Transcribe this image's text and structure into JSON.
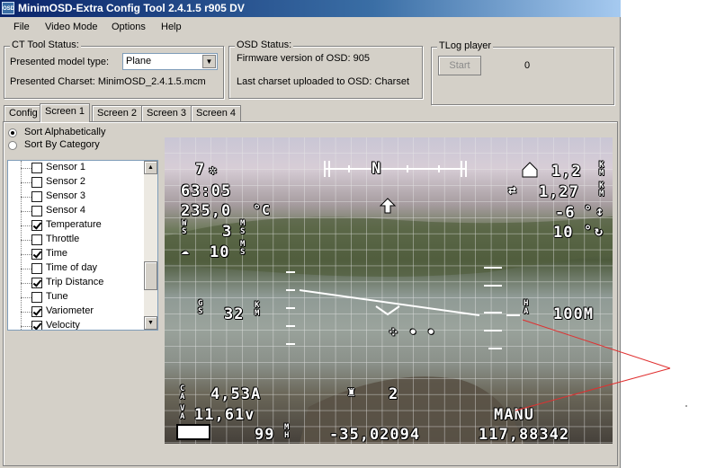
{
  "window": {
    "title": "MinimOSD-Extra Config Tool 2.4.1.5 r905 DV",
    "icon_label": "OSD"
  },
  "menu": [
    "File",
    "Video Mode",
    "Options",
    "Help"
  ],
  "ct_status": {
    "legend": "CT Tool Status:",
    "model_label": "Presented model type:",
    "model_value": "Plane",
    "charset_label": "Presented Charset: MinimOSD_2.4.1.5.mcm"
  },
  "osd_status": {
    "legend": "OSD Status:",
    "firmware": "Firmware version of OSD: 905",
    "charset": "Last charset uploaded to OSD: Charset"
  },
  "tlog": {
    "legend": "TLog player",
    "start_label": "Start",
    "count": "0"
  },
  "tabs": [
    {
      "label": "Config",
      "active": false
    },
    {
      "label": "Screen 1",
      "active": true
    },
    {
      "label": "Screen 2",
      "active": false
    },
    {
      "label": "Screen 3",
      "active": false
    },
    {
      "label": "Screen 4",
      "active": false
    }
  ],
  "sort": {
    "alphabetical": "Sort Alphabetically",
    "category": "Sort By Category",
    "selected": "alphabetical"
  },
  "items": [
    {
      "label": "Sensor 1",
      "checked": false
    },
    {
      "label": "Sensor 2",
      "checked": false
    },
    {
      "label": "Sensor 3",
      "checked": false
    },
    {
      "label": "Sensor 4",
      "checked": false
    },
    {
      "label": "Temperature",
      "checked": true
    },
    {
      "label": "Throttle",
      "checked": false
    },
    {
      "label": "Time",
      "checked": true
    },
    {
      "label": "Time of day",
      "checked": false
    },
    {
      "label": "Trip Distance",
      "checked": true
    },
    {
      "label": "Tune",
      "checked": false
    },
    {
      "label": "Variometer",
      "checked": true
    },
    {
      "label": "Velocity",
      "checked": true
    }
  ],
  "osd": {
    "sats": "7",
    "time": "63:05",
    "temp": "235,0",
    "temp_unit": "°C",
    "gps_speed": "3",
    "wind_speed": "10",
    "home_dist": "1,2",
    "trip_dist": "1,27",
    "vario": "-6",
    "vario_unit": "°",
    "heading_val": "10",
    "heading_unit": "°",
    "gs_speed": "32",
    "altitude": "100M",
    "current": "4,53A",
    "voltage": "11,61v",
    "mah": "99",
    "lat": "-35,02094",
    "lon": "117,88342",
    "mode": "MANU",
    "throttle": "2",
    "compass_n": "N"
  }
}
